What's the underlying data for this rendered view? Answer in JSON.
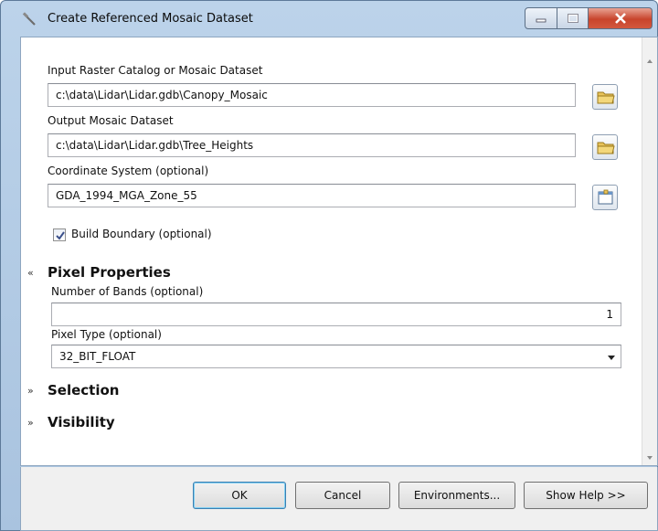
{
  "window": {
    "title": "Create Referenced Mosaic Dataset",
    "controls": {
      "minimize_icon": "minimize-icon",
      "maximize_icon": "maximize-icon",
      "close_icon": "close-icon"
    }
  },
  "form": {
    "input_catalog": {
      "label": "Input Raster Catalog or Mosaic Dataset",
      "value": "c:\\data\\Lidar\\Lidar.gdb\\Canopy_Mosaic"
    },
    "output_dataset": {
      "label": "Output Mosaic Dataset",
      "value": "c:\\data\\Lidar\\Lidar.gdb\\Tree_Heights"
    },
    "coordinate_system": {
      "label": "Coordinate System (optional)",
      "value": "GDA_1994_MGA_Zone_55"
    },
    "build_boundary": {
      "label": "Build Boundary (optional)",
      "checked": true
    }
  },
  "sections": {
    "pixel_properties": {
      "toggle": "«",
      "title": "Pixel Properties",
      "number_of_bands": {
        "label": "Number of Bands (optional)",
        "value": "1"
      },
      "pixel_type": {
        "label": "Pixel Type (optional)",
        "value": "32_BIT_FLOAT"
      }
    },
    "selection": {
      "toggle": "»",
      "title": "Selection"
    },
    "visibility": {
      "toggle": "»",
      "title": "Visibility"
    }
  },
  "buttons": {
    "ok": "OK",
    "cancel": "Cancel",
    "environments": "Environments...",
    "show_help": "Show Help >>"
  },
  "colors": {
    "title_gradient": "#bcd3ea",
    "close_button": "#c8442c",
    "folder_icon": "#e8c35a"
  }
}
